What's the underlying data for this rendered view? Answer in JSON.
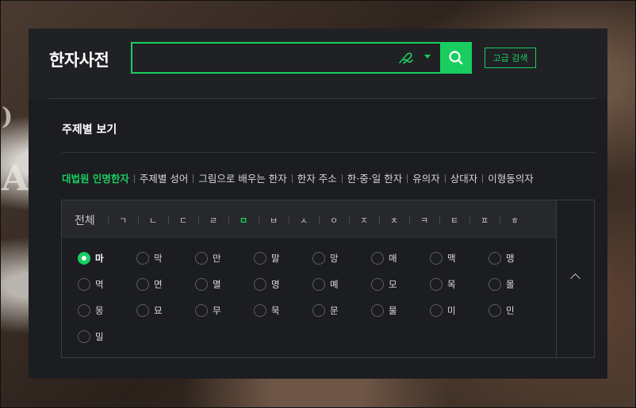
{
  "header": {
    "logo": "한자사전",
    "search_placeholder": "",
    "advanced_label": "고급 검색"
  },
  "section": {
    "title": "주제별 보기"
  },
  "categories": [
    {
      "label": "대법원 인명한자",
      "active": true
    },
    {
      "label": "주제별 성어",
      "active": false
    },
    {
      "label": "그림으로 배우는 한자",
      "active": false
    },
    {
      "label": "한자 주소",
      "active": false
    },
    {
      "label": "한·중·일 한자",
      "active": false
    },
    {
      "label": "유의자",
      "active": false
    },
    {
      "label": "상대자",
      "active": false
    },
    {
      "label": "이형동의자",
      "active": false
    }
  ],
  "letters": {
    "all": "전체",
    "items": [
      "ㄱ",
      "ㄴ",
      "ㄷ",
      "ㄹ",
      "ㅁ",
      "ㅂ",
      "ㅅ",
      "ㅇ",
      "ㅈ",
      "ㅊ",
      "ㅋ",
      "ㅌ",
      "ㅍ",
      "ㅎ"
    ],
    "active": "ㅁ"
  },
  "options": [
    "마",
    "막",
    "만",
    "말",
    "망",
    "매",
    "맥",
    "맹",
    "멱",
    "면",
    "멸",
    "명",
    "몌",
    "모",
    "목",
    "몰",
    "몽",
    "묘",
    "무",
    "묵",
    "문",
    "물",
    "미",
    "민",
    "밀"
  ],
  "selected_option": "마",
  "colors": {
    "accent": "#19ce60",
    "panel": "#202124"
  },
  "icons": {
    "search": "search-icon",
    "handwrite": "handwriting-icon",
    "dropdown": "caret-down-icon",
    "collapse": "chevron-up-icon"
  }
}
